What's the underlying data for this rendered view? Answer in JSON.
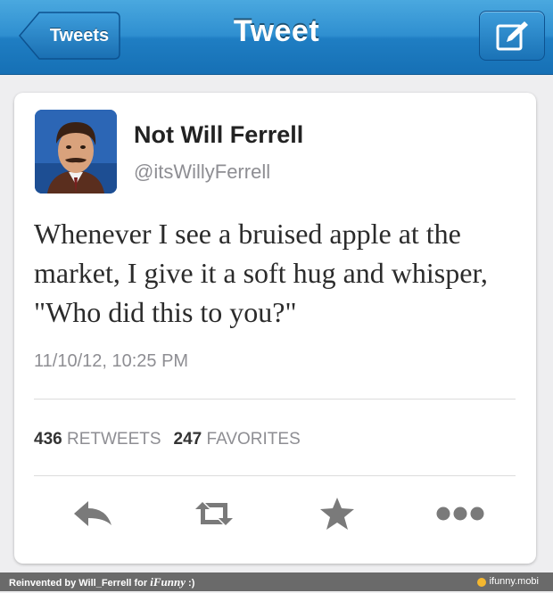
{
  "nav": {
    "back_label": "Tweets",
    "title": "Tweet",
    "compose_icon": "compose-icon"
  },
  "tweet": {
    "author_name": "Not Will Ferrell",
    "author_handle": "@itsWillyFerrell",
    "text": "Whenever I see a bruised apple at the market, I give it a soft hug and whisper, \"Who did this to you?\"",
    "timestamp": "11/10/12, 10:25 PM",
    "retweets_count": "436",
    "retweets_label": "RETWEETS",
    "favorites_count": "247",
    "favorites_label": "FAVORITES"
  },
  "actions": [
    {
      "name": "reply",
      "icon": "reply-icon"
    },
    {
      "name": "retweet",
      "icon": "retweet-icon"
    },
    {
      "name": "favorite",
      "icon": "star-icon"
    },
    {
      "name": "more",
      "icon": "more-icon"
    }
  ],
  "footer": {
    "left_text": "Reinvented by Will_Ferrell for ",
    "brand": "iFunny",
    "left_suffix": " :)",
    "right_text": "ifunny.mobi"
  },
  "colors": {
    "nav_blue": "#2f8fd0",
    "text_dark": "#2b2b2b",
    "text_gray": "#8e8e93",
    "icon_gray": "#7a7a7a"
  }
}
